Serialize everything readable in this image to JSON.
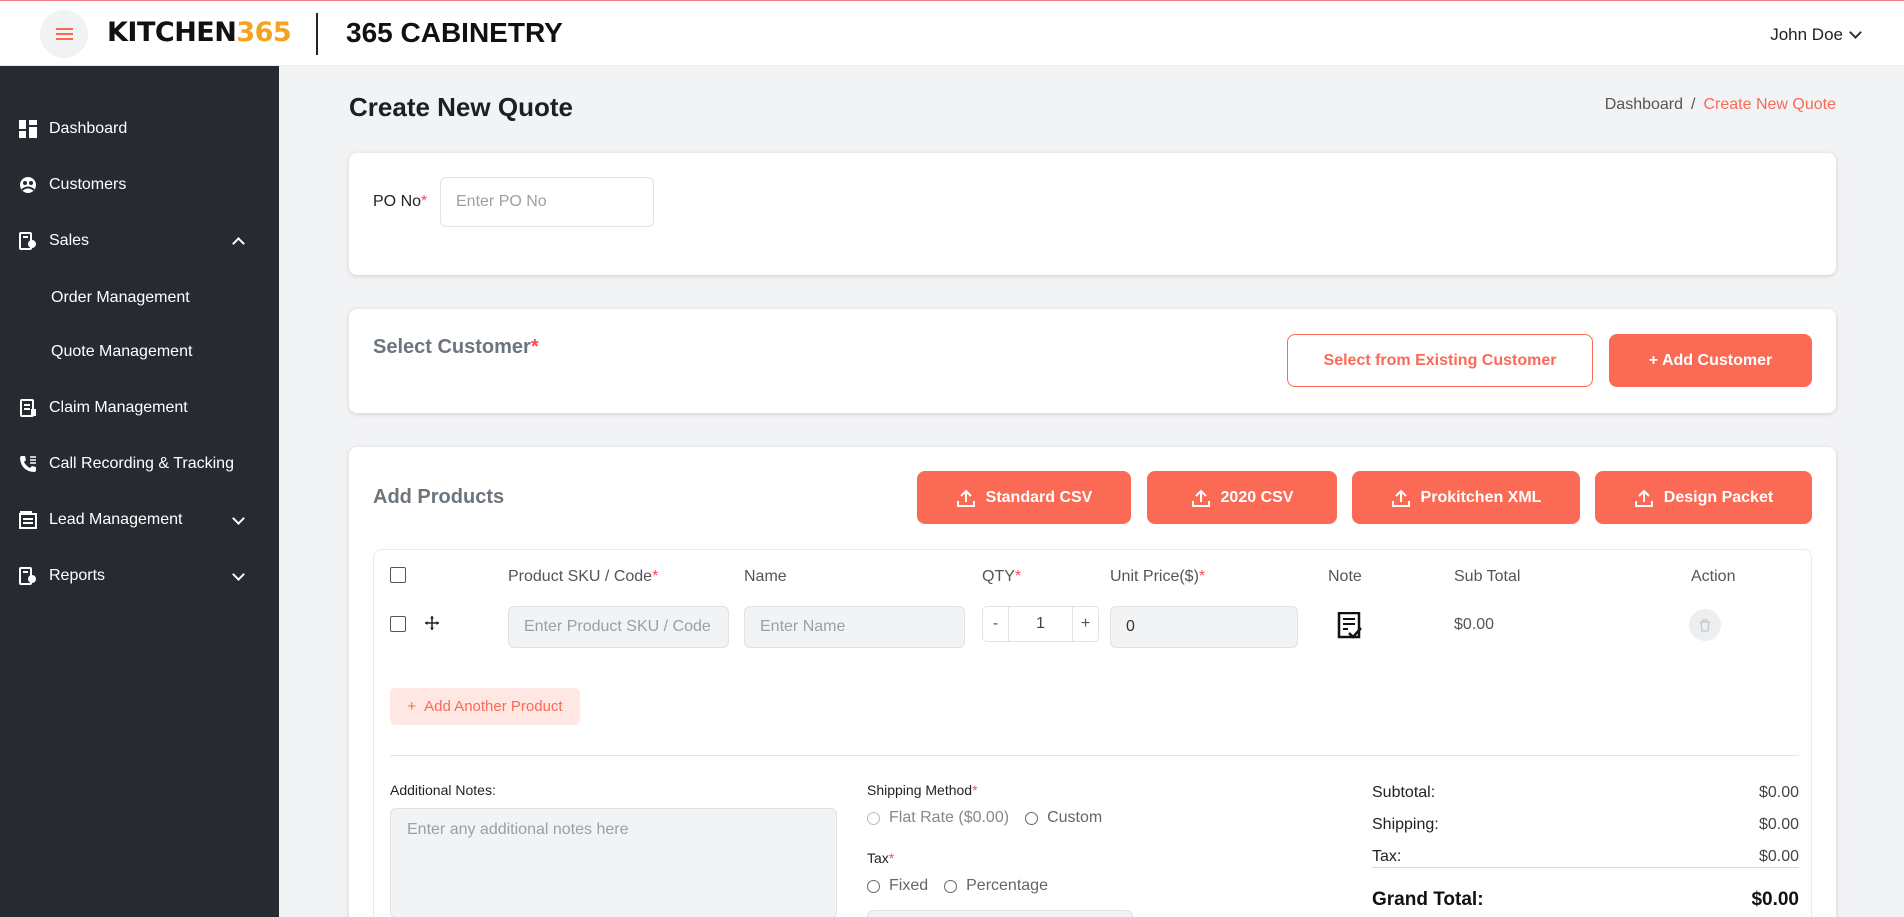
{
  "header": {
    "logo_text": "KITCHEN",
    "logo_number": "365",
    "brand": "365 CABINETRY",
    "user_name": "John Doe"
  },
  "sidebar": {
    "items": [
      {
        "label": "Dashboard",
        "icon": "dashboard-icon"
      },
      {
        "label": "Customers",
        "icon": "customers-icon"
      },
      {
        "label": "Sales",
        "icon": "sales-icon",
        "expanded": true
      },
      {
        "label": "Claim Management",
        "icon": "claim-icon"
      },
      {
        "label": "Call Recording & Tracking",
        "icon": "phone-icon"
      },
      {
        "label": "Lead Management",
        "icon": "lead-icon",
        "expanded": false
      },
      {
        "label": "Reports",
        "icon": "reports-icon",
        "expanded": false
      }
    ],
    "sales_sub": [
      "Order Management",
      "Quote Management"
    ]
  },
  "page": {
    "title": "Create New Quote",
    "breadcrumb": {
      "home": "Dashboard",
      "separator": "/",
      "current": "Create New Quote"
    }
  },
  "po": {
    "label": "PO No",
    "required": "*",
    "placeholder": "Enter PO No"
  },
  "customer": {
    "title": "Select Customer",
    "required": "*",
    "select_existing": "Select from Existing Customer",
    "add_customer": "+ Add Customer"
  },
  "products": {
    "title": "Add Products",
    "uploads": [
      "Standard CSV",
      "2020 CSV",
      "Prokitchen XML",
      "Design Packet"
    ],
    "columns": {
      "sku": "Product SKU / Code",
      "name": "Name",
      "qty": "QTY",
      "unit_price": "Unit Price($)",
      "note": "Note",
      "sub_total": "Sub Total",
      "action": "Action"
    },
    "required": "*",
    "row": {
      "sku_placeholder": "Enter Product SKU / Code",
      "name_placeholder": "Enter Name",
      "qty_minus": "-",
      "qty": "1",
      "qty_plus": "+",
      "unit_price": "0",
      "sub_total": "$0.00"
    },
    "add_another": "Add Another Product"
  },
  "notes": {
    "label": "Additional Notes:",
    "placeholder": "Enter any additional notes here"
  },
  "shipping": {
    "label": "Shipping Method",
    "required": "*",
    "options": [
      "Flat Rate ($0.00)",
      "Custom"
    ]
  },
  "tax": {
    "label": "Tax",
    "required": "*",
    "options": [
      "Fixed",
      "Percentage"
    ]
  },
  "summary": {
    "subtotal_label": "Subtotal:",
    "subtotal": "$0.00",
    "shipping_label": "Shipping:",
    "shipping": "$0.00",
    "tax_label": "Tax:",
    "tax": "$0.00",
    "grand_label": "Grand Total:",
    "grand": "$0.00"
  },
  "colors": {
    "accent": "#fa6a55",
    "sidebar": "#272a31",
    "logo_number": "#f5a21f"
  }
}
